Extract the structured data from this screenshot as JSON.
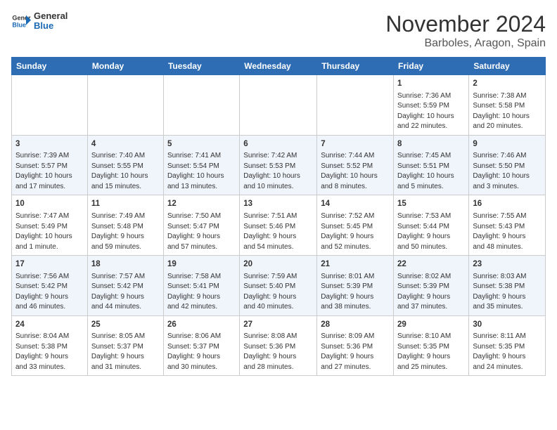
{
  "header": {
    "logo_line1": "General",
    "logo_line2": "Blue",
    "month": "November 2024",
    "location": "Barboles, Aragon, Spain"
  },
  "weekdays": [
    "Sunday",
    "Monday",
    "Tuesday",
    "Wednesday",
    "Thursday",
    "Friday",
    "Saturday"
  ],
  "weeks": [
    [
      {
        "day": "",
        "info": ""
      },
      {
        "day": "",
        "info": ""
      },
      {
        "day": "",
        "info": ""
      },
      {
        "day": "",
        "info": ""
      },
      {
        "day": "",
        "info": ""
      },
      {
        "day": "1",
        "info": "Sunrise: 7:36 AM\nSunset: 5:59 PM\nDaylight: 10 hours\nand 22 minutes."
      },
      {
        "day": "2",
        "info": "Sunrise: 7:38 AM\nSunset: 5:58 PM\nDaylight: 10 hours\nand 20 minutes."
      }
    ],
    [
      {
        "day": "3",
        "info": "Sunrise: 7:39 AM\nSunset: 5:57 PM\nDaylight: 10 hours\nand 17 minutes."
      },
      {
        "day": "4",
        "info": "Sunrise: 7:40 AM\nSunset: 5:55 PM\nDaylight: 10 hours\nand 15 minutes."
      },
      {
        "day": "5",
        "info": "Sunrise: 7:41 AM\nSunset: 5:54 PM\nDaylight: 10 hours\nand 13 minutes."
      },
      {
        "day": "6",
        "info": "Sunrise: 7:42 AM\nSunset: 5:53 PM\nDaylight: 10 hours\nand 10 minutes."
      },
      {
        "day": "7",
        "info": "Sunrise: 7:44 AM\nSunset: 5:52 PM\nDaylight: 10 hours\nand 8 minutes."
      },
      {
        "day": "8",
        "info": "Sunrise: 7:45 AM\nSunset: 5:51 PM\nDaylight: 10 hours\nand 5 minutes."
      },
      {
        "day": "9",
        "info": "Sunrise: 7:46 AM\nSunset: 5:50 PM\nDaylight: 10 hours\nand 3 minutes."
      }
    ],
    [
      {
        "day": "10",
        "info": "Sunrise: 7:47 AM\nSunset: 5:49 PM\nDaylight: 10 hours\nand 1 minute."
      },
      {
        "day": "11",
        "info": "Sunrise: 7:49 AM\nSunset: 5:48 PM\nDaylight: 9 hours\nand 59 minutes."
      },
      {
        "day": "12",
        "info": "Sunrise: 7:50 AM\nSunset: 5:47 PM\nDaylight: 9 hours\nand 57 minutes."
      },
      {
        "day": "13",
        "info": "Sunrise: 7:51 AM\nSunset: 5:46 PM\nDaylight: 9 hours\nand 54 minutes."
      },
      {
        "day": "14",
        "info": "Sunrise: 7:52 AM\nSunset: 5:45 PM\nDaylight: 9 hours\nand 52 minutes."
      },
      {
        "day": "15",
        "info": "Sunrise: 7:53 AM\nSunset: 5:44 PM\nDaylight: 9 hours\nand 50 minutes."
      },
      {
        "day": "16",
        "info": "Sunrise: 7:55 AM\nSunset: 5:43 PM\nDaylight: 9 hours\nand 48 minutes."
      }
    ],
    [
      {
        "day": "17",
        "info": "Sunrise: 7:56 AM\nSunset: 5:42 PM\nDaylight: 9 hours\nand 46 minutes."
      },
      {
        "day": "18",
        "info": "Sunrise: 7:57 AM\nSunset: 5:42 PM\nDaylight: 9 hours\nand 44 minutes."
      },
      {
        "day": "19",
        "info": "Sunrise: 7:58 AM\nSunset: 5:41 PM\nDaylight: 9 hours\nand 42 minutes."
      },
      {
        "day": "20",
        "info": "Sunrise: 7:59 AM\nSunset: 5:40 PM\nDaylight: 9 hours\nand 40 minutes."
      },
      {
        "day": "21",
        "info": "Sunrise: 8:01 AM\nSunset: 5:39 PM\nDaylight: 9 hours\nand 38 minutes."
      },
      {
        "day": "22",
        "info": "Sunrise: 8:02 AM\nSunset: 5:39 PM\nDaylight: 9 hours\nand 37 minutes."
      },
      {
        "day": "23",
        "info": "Sunrise: 8:03 AM\nSunset: 5:38 PM\nDaylight: 9 hours\nand 35 minutes."
      }
    ],
    [
      {
        "day": "24",
        "info": "Sunrise: 8:04 AM\nSunset: 5:38 PM\nDaylight: 9 hours\nand 33 minutes."
      },
      {
        "day": "25",
        "info": "Sunrise: 8:05 AM\nSunset: 5:37 PM\nDaylight: 9 hours\nand 31 minutes."
      },
      {
        "day": "26",
        "info": "Sunrise: 8:06 AM\nSunset: 5:37 PM\nDaylight: 9 hours\nand 30 minutes."
      },
      {
        "day": "27",
        "info": "Sunrise: 8:08 AM\nSunset: 5:36 PM\nDaylight: 9 hours\nand 28 minutes."
      },
      {
        "day": "28",
        "info": "Sunrise: 8:09 AM\nSunset: 5:36 PM\nDaylight: 9 hours\nand 27 minutes."
      },
      {
        "day": "29",
        "info": "Sunrise: 8:10 AM\nSunset: 5:35 PM\nDaylight: 9 hours\nand 25 minutes."
      },
      {
        "day": "30",
        "info": "Sunrise: 8:11 AM\nSunset: 5:35 PM\nDaylight: 9 hours\nand 24 minutes."
      }
    ]
  ]
}
